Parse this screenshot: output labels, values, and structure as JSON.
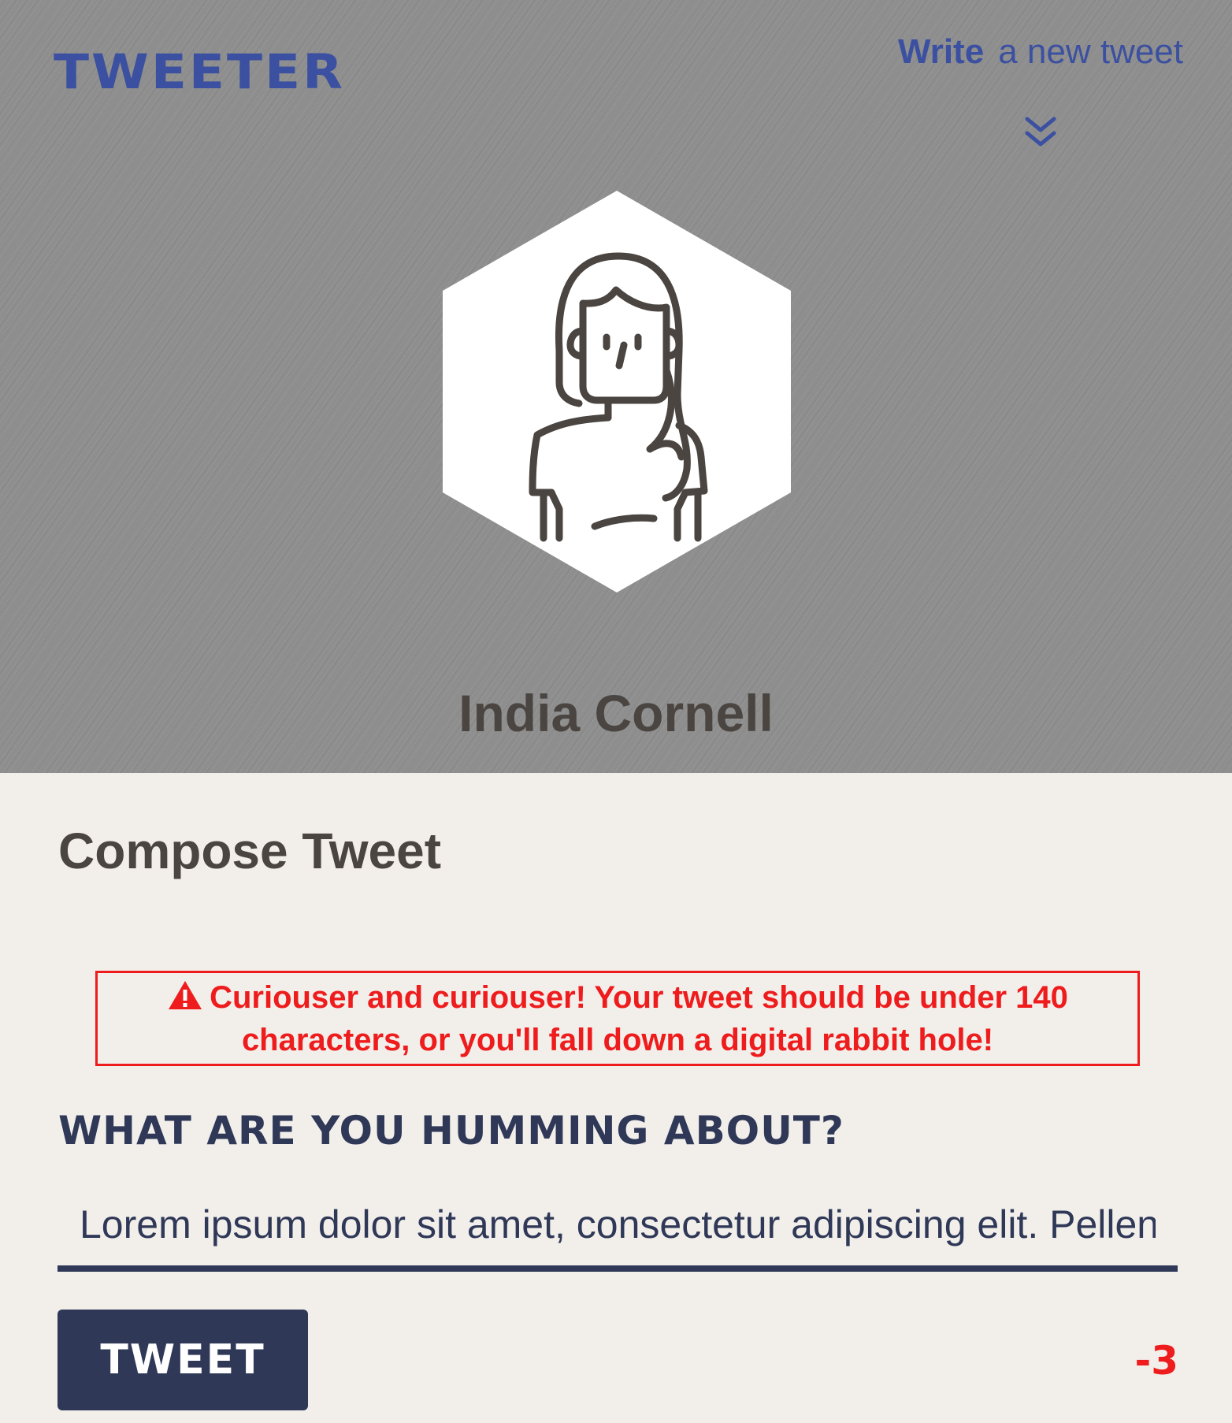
{
  "nav": {
    "logo_text": "Tweeter",
    "write_strong": "Write",
    "write_rest": "a new tweet",
    "chevron_icon": "double-chevron-down-icon"
  },
  "profile": {
    "avatar_icon": "woman-avatar-icon",
    "name": "India Cornell"
  },
  "compose": {
    "title": "Compose Tweet",
    "error_icon": "warning-triangle-icon",
    "error_message": "Curiouser and curiouser! Your tweet should be under 140 characters, or you'll fall down a digital rabbit hole!",
    "prompt_label": "What are you humming about?",
    "input_value": "Lorem ipsum dolor sit amet, consectetur adipiscing elit. Pellentesque habitant morbi tristique senectus et netus et malesuada fames ac turpis egestas.",
    "button_label": "Tweet",
    "counter": "-3"
  },
  "colors": {
    "brand": "#3b50a0",
    "navy": "#2f3857",
    "error": "#ee1c1c",
    "page_bg": "#f2efeb",
    "header_bg": "#8e8e8e"
  }
}
